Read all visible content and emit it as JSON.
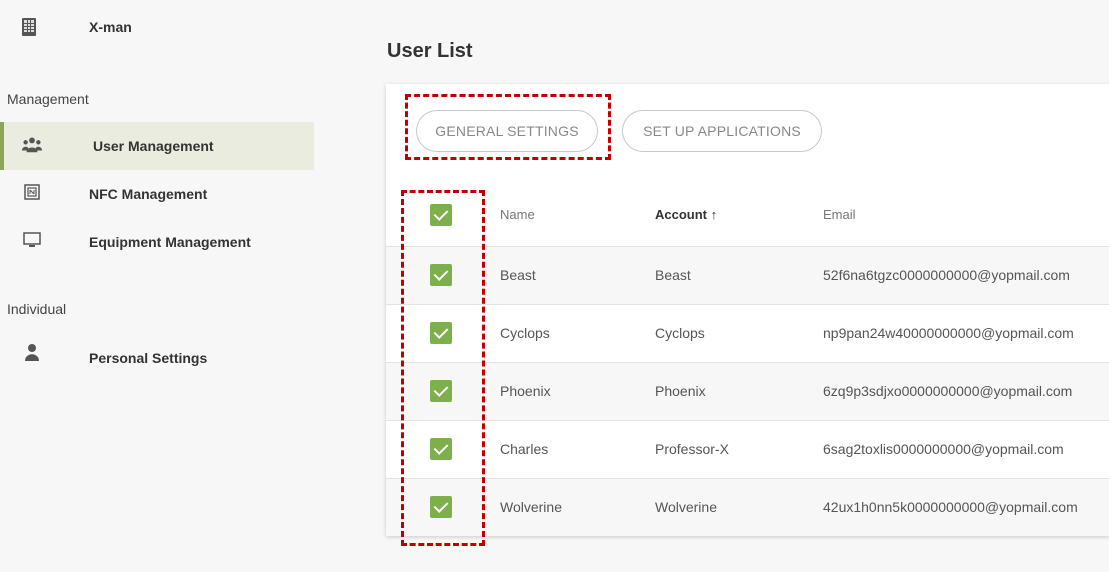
{
  "org": {
    "name": "X-man",
    "icon": "building-icon"
  },
  "sidebar": {
    "sections": [
      {
        "label": "Management"
      },
      {
        "label": "Individual"
      }
    ],
    "items": [
      {
        "label": "User Management",
        "icon": "users-icon",
        "active": true
      },
      {
        "label": "NFC Management",
        "icon": "nfc-icon",
        "active": false
      },
      {
        "label": "Equipment Management",
        "icon": "monitor-icon",
        "active": false
      },
      {
        "label": "Personal Settings",
        "icon": "user-icon",
        "active": false
      }
    ]
  },
  "main": {
    "title": "User List",
    "buttons": {
      "general_settings": "GENERAL SETTINGS",
      "set_up_applications": "SET UP APPLICATIONS"
    },
    "table": {
      "headers": {
        "name": "Name",
        "account": "Account ↑",
        "email": "Email"
      },
      "rows": [
        {
          "name": "Beast",
          "account": "Beast",
          "email": "52f6na6tgzc0000000000@yopmail.com",
          "checked": true
        },
        {
          "name": "Cyclops",
          "account": "Cyclops",
          "email": "np9pan24w40000000000@yopmail.com",
          "checked": true
        },
        {
          "name": "Phoenix",
          "account": "Phoenix",
          "email": "6zq9p3sdjxo0000000000@yopmail.com",
          "checked": true
        },
        {
          "name": "Charles",
          "account": "Professor-X",
          "email": "6sag2toxlis0000000000@yopmail.com",
          "checked": true
        },
        {
          "name": "Wolverine",
          "account": "Wolverine",
          "email": "42ux1h0nn5k0000000000@yopmail.com",
          "checked": true
        }
      ]
    }
  },
  "colors": {
    "accent": "#7db04a",
    "active_bg": "#e9ecdf",
    "highlight": "#c00000"
  }
}
